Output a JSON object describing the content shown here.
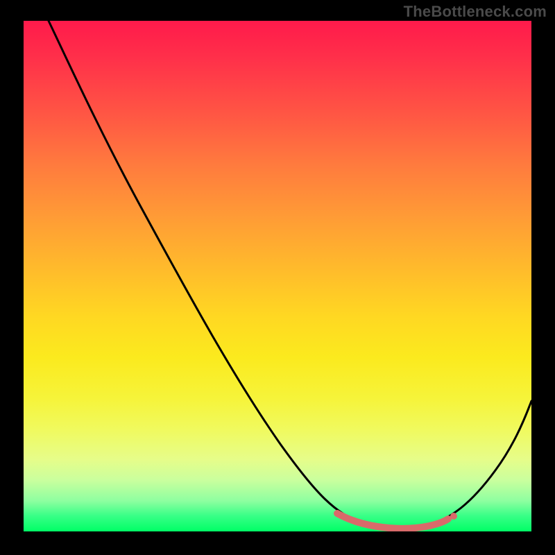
{
  "watermark": "TheBottleneck.com",
  "chart_data": {
    "type": "line",
    "title": "",
    "xlabel": "",
    "ylabel": "",
    "xlim": [
      0,
      100
    ],
    "ylim": [
      0,
      100
    ],
    "grid": false,
    "legend": false,
    "series": [
      {
        "name": "main-curve",
        "color": "#000000",
        "x": [
          5,
          10,
          20,
          30,
          40,
          50,
          58,
          62,
          66,
          70,
          74,
          78,
          82,
          86,
          90,
          95,
          100
        ],
        "y": [
          100,
          92,
          76,
          60,
          44,
          29,
          16,
          10,
          5,
          2,
          1,
          1,
          2,
          4,
          9,
          18,
          30
        ]
      },
      {
        "name": "highlight-segment",
        "color": "#d96a6a",
        "x": [
          62,
          66,
          70,
          74,
          78,
          82
        ],
        "y": [
          10,
          5,
          2,
          1,
          1,
          2
        ]
      }
    ],
    "highlight_point": {
      "x": 82,
      "y": 2,
      "color": "#d96a6a"
    }
  }
}
